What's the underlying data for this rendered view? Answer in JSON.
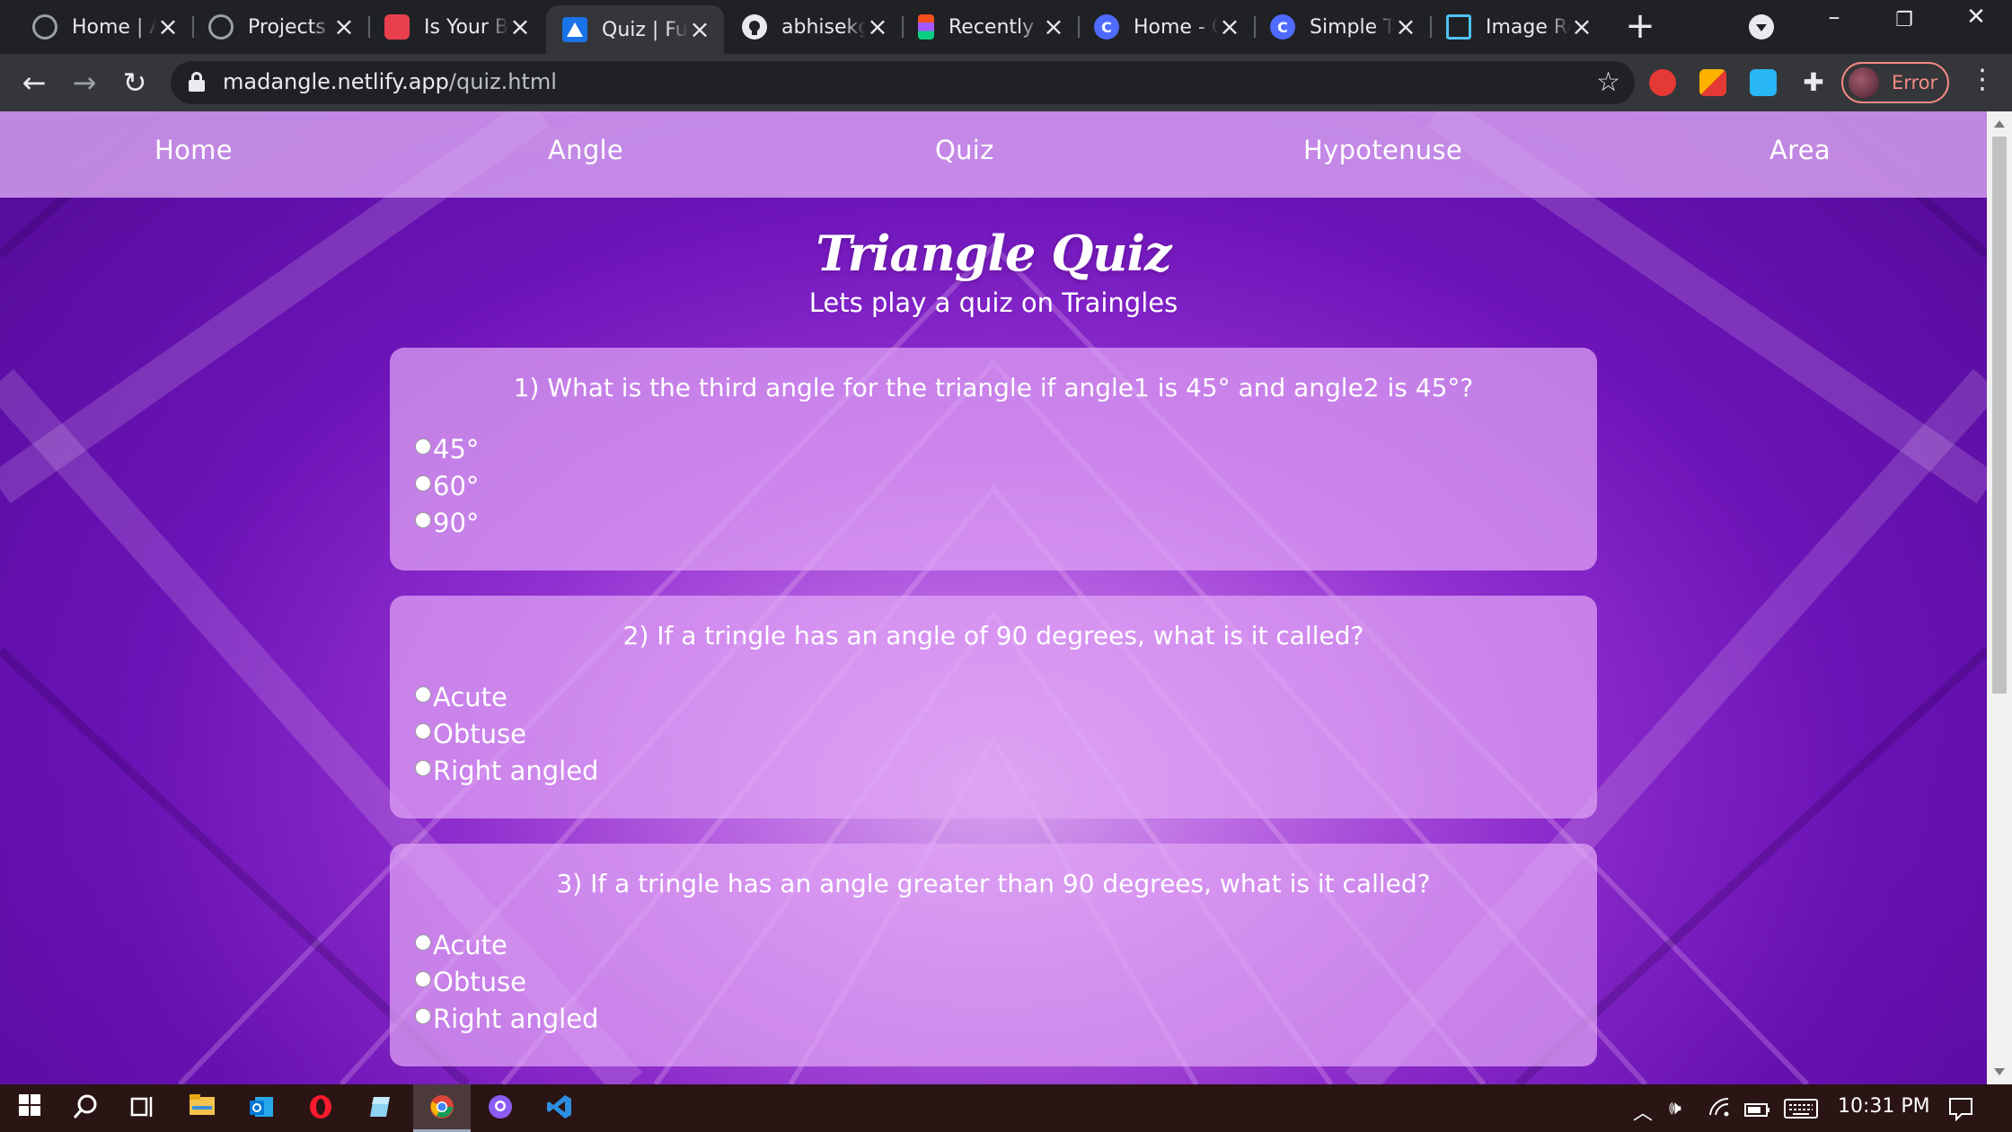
{
  "browser": {
    "tabs": [
      {
        "title": "Home | A",
        "favicon": "globe-icon"
      },
      {
        "title": "Projects |",
        "favicon": "globe-icon"
      },
      {
        "title": "Is Your Bi",
        "favicon": "cake-icon"
      },
      {
        "title": "Quiz | Fu",
        "favicon": "triangle-icon",
        "active": true
      },
      {
        "title": "abhisekg",
        "favicon": "github-icon"
      },
      {
        "title": "Recently",
        "favicon": "figma-icon"
      },
      {
        "title": "Home - C",
        "favicon": "c-logo-icon"
      },
      {
        "title": "Simple Te",
        "favicon": "c-logo-icon"
      },
      {
        "title": "Image Re",
        "favicon": "image-resize-icon"
      }
    ],
    "url_domain": "madangle.netlify.app",
    "url_path": "/quiz.html",
    "profile_status": "Error",
    "accent": "#f28b82"
  },
  "site": {
    "nav": [
      "Home",
      "Angle",
      "Quiz",
      "Hypotenuse",
      "Area"
    ],
    "title": "Triangle Quiz",
    "subtitle": "Lets play a quiz on Traingles",
    "questions": [
      {
        "text": "1) What is the third angle for the triangle if angle1 is 45° and angle2 is 45°?",
        "options": [
          "45°",
          "60°",
          "90°"
        ]
      },
      {
        "text": "2) If a tringle has an angle of 90 degrees, what is it called?",
        "options": [
          "Acute",
          "Obtuse",
          "Right angled"
        ]
      },
      {
        "text": "3) If a tringle has an angle greater than 90 degrees, what is it called?",
        "options": [
          "Acute",
          "Obtuse",
          "Right angled"
        ]
      }
    ]
  },
  "taskbar": {
    "apps": [
      "windows-start-icon",
      "search-icon",
      "task-view-icon",
      "file-explorer-icon",
      "outlook-icon",
      "opera-icon",
      "notepad-icon",
      "chrome-icon",
      "github-desktop-icon",
      "vscode-icon"
    ],
    "time": "10:31 PM"
  }
}
